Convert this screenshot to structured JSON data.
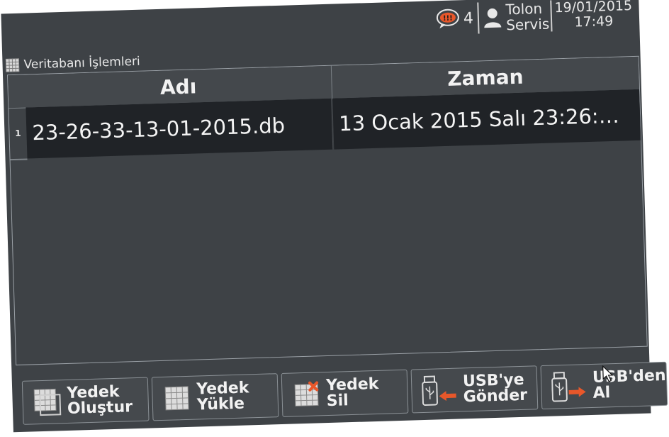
{
  "status": {
    "alarm_count": "4",
    "user_line1": "Tolon",
    "user_line2": "Servis",
    "date": "19/01/2015",
    "time": "17:49"
  },
  "window": {
    "title": "Veritabanı İşlemleri"
  },
  "table": {
    "columns": [
      "Adı",
      "Zaman"
    ],
    "rows": [
      {
        "num": "1",
        "name": "23-26-33-13-01-2015.db",
        "time": "13 Ocak 2015 Salı 23:26:…"
      }
    ]
  },
  "toolbar": {
    "create_line1": "Yedek",
    "create_line2": "Oluştur",
    "load_line1": "Yedek",
    "load_line2": "Yükle",
    "delete_line1": "Yedek",
    "delete_line2": "Sil",
    "usb_send_line1": "USB'ye",
    "usb_send_line2": "Gönder",
    "usb_get_line1": "USB'den",
    "usb_get_line2": "Al"
  },
  "colors": {
    "screen_bg": "#3e4246",
    "row_bg": "#202327",
    "accent_orange": "#e8572a"
  }
}
